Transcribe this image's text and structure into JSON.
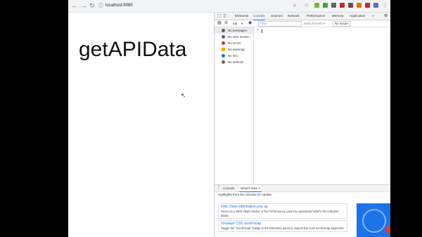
{
  "browser": {
    "url": "localhost:8080",
    "nav": {
      "back": "←",
      "forward": "→",
      "reload": "↻"
    }
  },
  "page": {
    "heading": "getAPIData"
  },
  "devtools": {
    "tabs": [
      "Elements",
      "Console",
      "Sources",
      "Network",
      "Performance",
      "Memory",
      "Application",
      "»"
    ],
    "active_tab": "Console",
    "toolbar": {
      "context": "top",
      "filter_placeholder": "Filter",
      "levels": "Default levels ▾",
      "issues": "No Issues"
    },
    "sidebar": [
      {
        "label": "No messages",
        "icon": "list-icon",
        "color": "#5f6368"
      },
      {
        "label": "No user messa...",
        "icon": "user-icon",
        "color": "#5f6368"
      },
      {
        "label": "No errors",
        "icon": "error-icon",
        "color": "#d93025"
      },
      {
        "label": "No warnings",
        "icon": "warning-icon",
        "color": "#f9ab00"
      },
      {
        "label": "No info",
        "icon": "info-icon",
        "color": "#1a73e8"
      },
      {
        "label": "No verbose",
        "icon": "verbose-icon",
        "color": "#5f6368"
      }
    ],
    "console_prompt": ">",
    "drawer": {
      "tabs": [
        "Console",
        "What's New ×"
      ],
      "active_tab": "What's New ×",
      "highlights": "Highlights from the Chrome 87 update",
      "cards": [
        {
          "title": "Web Vitals information pop up",
          "body": "Hover on a Web Vitals marker in the Performance panel to understand what's the indicator about."
        },
        {
          "title": "Visualize CSS scroll-snap",
          "body": "Toggle the \"scroll-snap\" badge in the Elements panel to inspect the CSS scroll-snap alignment."
        }
      ]
    }
  }
}
